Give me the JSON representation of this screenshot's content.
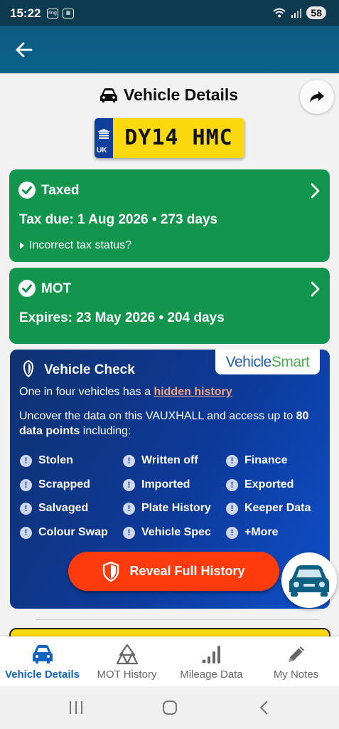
{
  "status_bar": {
    "time": "15:22",
    "battery": "58"
  },
  "page": {
    "title": "Vehicle Details"
  },
  "plate": {
    "country": "UK",
    "registration": "DY14 HMC"
  },
  "tax_card": {
    "title": "Taxed",
    "line": "Tax due: 1 Aug 2026 • 273 days",
    "sub": "Incorrect tax status?",
    "color": "#12964d"
  },
  "mot_card": {
    "title": "MOT",
    "line": "Expires: 23 May 2026 • 204 days",
    "color": "#12964d"
  },
  "vehicle_check": {
    "title": "Vehicle Check",
    "logo_a": "Vehicle",
    "logo_b": "Smart",
    "intro_prefix": "One in four vehicles has a ",
    "intro_link": "hidden history",
    "desc_prefix": "Uncover the data on this VAUXHALL and access up to ",
    "desc_bold": "80 data points",
    "desc_suffix": " including:",
    "features": [
      "Stolen",
      "Written off",
      "Finance",
      "Scrapped",
      "Imported",
      "Exported",
      "Salvaged",
      "Plate History",
      "Keeper Data",
      "Colour Swap",
      "Vehicle Spec",
      "+More"
    ],
    "button": "Reveal Full History",
    "button_color": "#ff3b0d"
  },
  "bottom_nav": {
    "items": [
      {
        "label": "Vehicle Details",
        "icon": "car-icon",
        "active": true
      },
      {
        "label": "MOT History",
        "icon": "mot-triangle-icon",
        "active": false
      },
      {
        "label": "Mileage Data",
        "icon": "bar-signal-icon",
        "active": false
      },
      {
        "label": "My Notes",
        "icon": "pencil-icon",
        "active": false
      }
    ]
  },
  "colors": {
    "header": "#0a6189",
    "accent": "#1565c0",
    "plate_yellow": "#fbd90f"
  }
}
